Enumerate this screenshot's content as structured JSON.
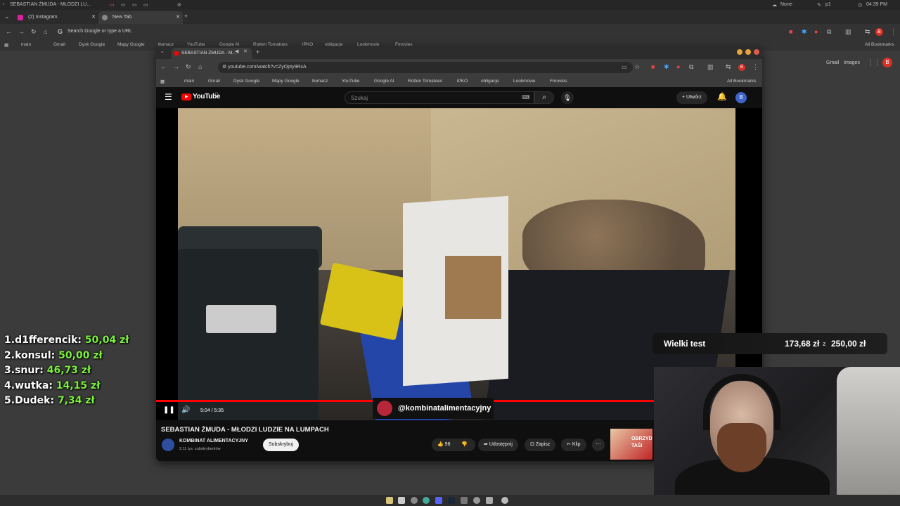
{
  "os_bar": {
    "title": "SEBASTIAN ŻMUDA - MŁODZI LU...",
    "weather": "None",
    "user": "p1",
    "clock": "04:39 PM"
  },
  "outer_browser": {
    "tabs": [
      {
        "label": "(2) Instagram"
      },
      {
        "label": "New Tab"
      }
    ],
    "address_placeholder": "Search Google or type a URL",
    "bookmarks": [
      "main",
      "Gmail",
      "Dysk Google",
      "Mapy Google",
      "tłumacz",
      "YouTube",
      "Google AI",
      "Rotten Tomatoes",
      "iPKO",
      "obligacje",
      "Lookmovie",
      "Fmovies"
    ],
    "all_bookmarks": "All Bookmarks",
    "right_links": [
      "Gmail",
      "Images"
    ],
    "avatar": "B"
  },
  "inner_browser": {
    "tab_title": "SEBASTIAN ŻMUDA - M...",
    "url": "youtube.com/watch?v=ZyOpty9RxA",
    "bookmarks": [
      "main",
      "Gmail",
      "Dysk Google",
      "Mapy Google",
      "tłumacz",
      "YouTube",
      "Google AI",
      "Rotten Tomatoes",
      "iPKO",
      "obligacje",
      "Lookmovie",
      "Fmovies"
    ],
    "all_bookmarks": "All Bookmarks"
  },
  "youtube": {
    "logo": "YouTube",
    "country": "PL",
    "search_placeholder": "Szukaj",
    "create_label": "Utwórz",
    "avatar": "B",
    "video": {
      "time": "5:04 / 5:35",
      "progress": 0.907,
      "overlay_handle": "@kombinatalimentacyjny",
      "title": "SEBASTIAN ŻMUDA - MŁODZI LUDZIE NA LUMPACH"
    },
    "channel": {
      "name": "KOMBINAT ALIMENTACYJNY",
      "subs": "2,11 tys. subskrybentów",
      "subscribe": "Subskrybuj"
    },
    "actions": {
      "likes": "98",
      "share": "Udostępnij",
      "save": "Zapisz",
      "clip": "Klip"
    },
    "ad_text": "OBRZYD TAŚI"
  },
  "leaderboard": [
    {
      "rank": "1.",
      "name": "d1fferencik:",
      "amount": "50,04 zł"
    },
    {
      "rank": "2.",
      "name": "konsul:",
      "amount": "50,00 zł"
    },
    {
      "rank": "3.",
      "name": "snur:",
      "amount": "46,73 zł"
    },
    {
      "rank": "4.",
      "name": "wutka:",
      "amount": "14,15 zł"
    },
    {
      "rank": "5.",
      "name": "Dudek:",
      "amount": "7,34 zł"
    }
  ],
  "goal": {
    "label": "Wielki test",
    "current": "173,68 zł",
    "separator": "z",
    "target": "250,00 zł"
  },
  "colors": {
    "accent_green": "#7cf03c",
    "yt_red": "#ff0000"
  }
}
